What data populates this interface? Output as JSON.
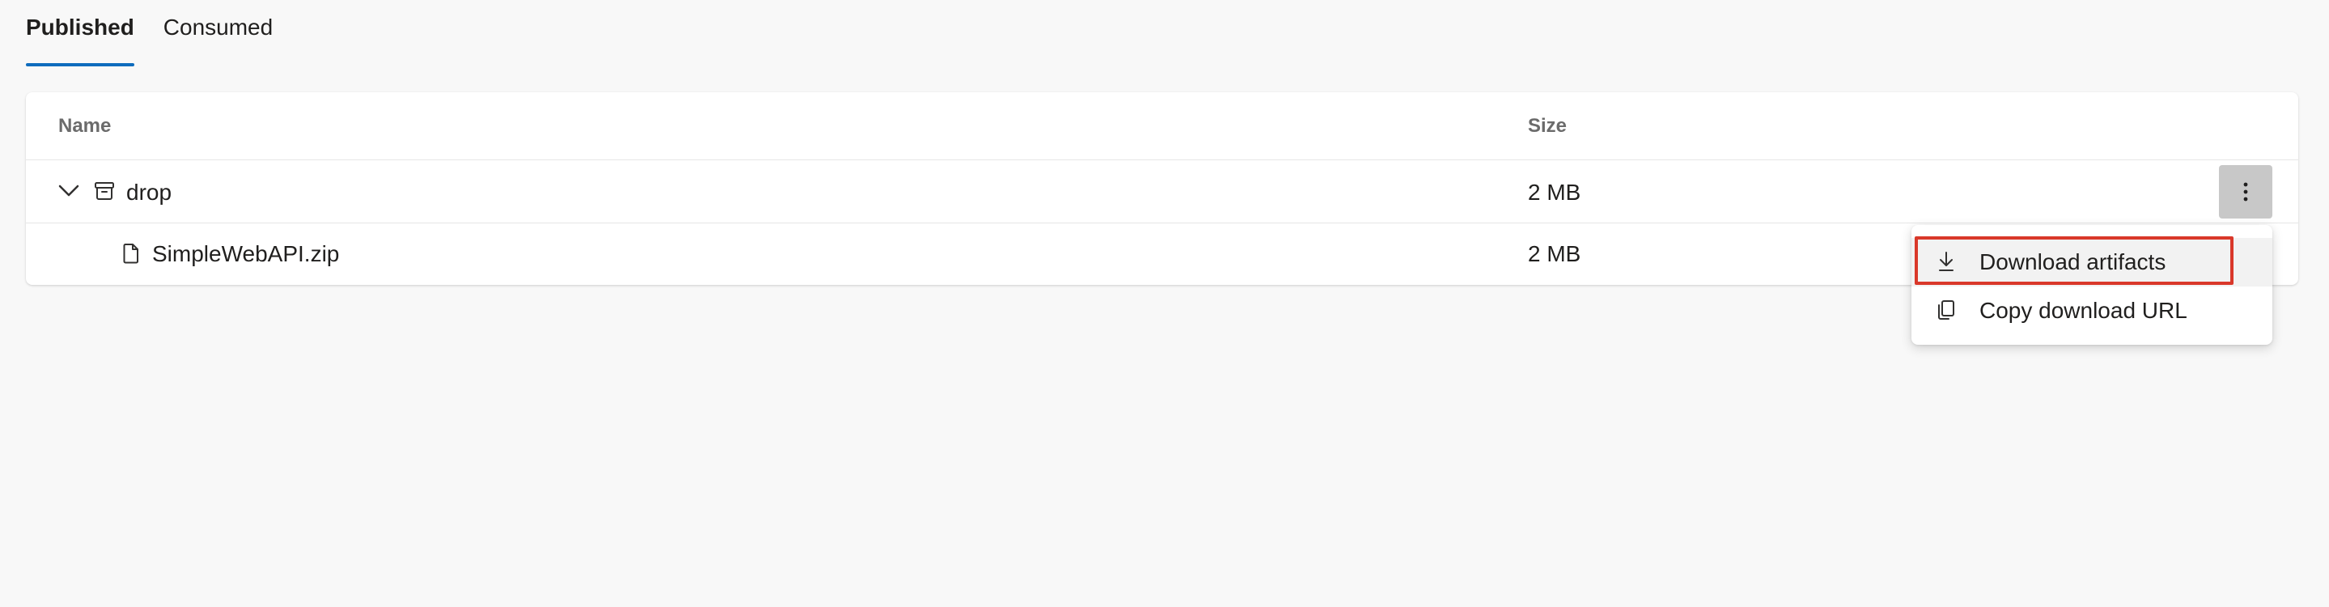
{
  "tabs": [
    {
      "label": "Published",
      "selected": true
    },
    {
      "label": "Consumed",
      "selected": false
    }
  ],
  "table": {
    "columns": {
      "name": "Name",
      "size": "Size"
    },
    "rows": [
      {
        "name": "drop",
        "size": "2 MB",
        "type": "folder",
        "icon": "archive-icon",
        "expanded": true
      },
      {
        "name": "SimpleWebAPI.zip",
        "size": "2 MB",
        "type": "file",
        "icon": "file-icon"
      }
    ]
  },
  "context_menu": {
    "items": [
      {
        "label": "Download artifacts",
        "icon": "download-icon",
        "highlighted": true
      },
      {
        "label": "Copy download URL",
        "icon": "copy-icon",
        "highlighted": false
      }
    ]
  },
  "colors": {
    "accent": "#0f6cbd",
    "highlight_border": "#d9382a",
    "background": "#f8f8f8"
  }
}
